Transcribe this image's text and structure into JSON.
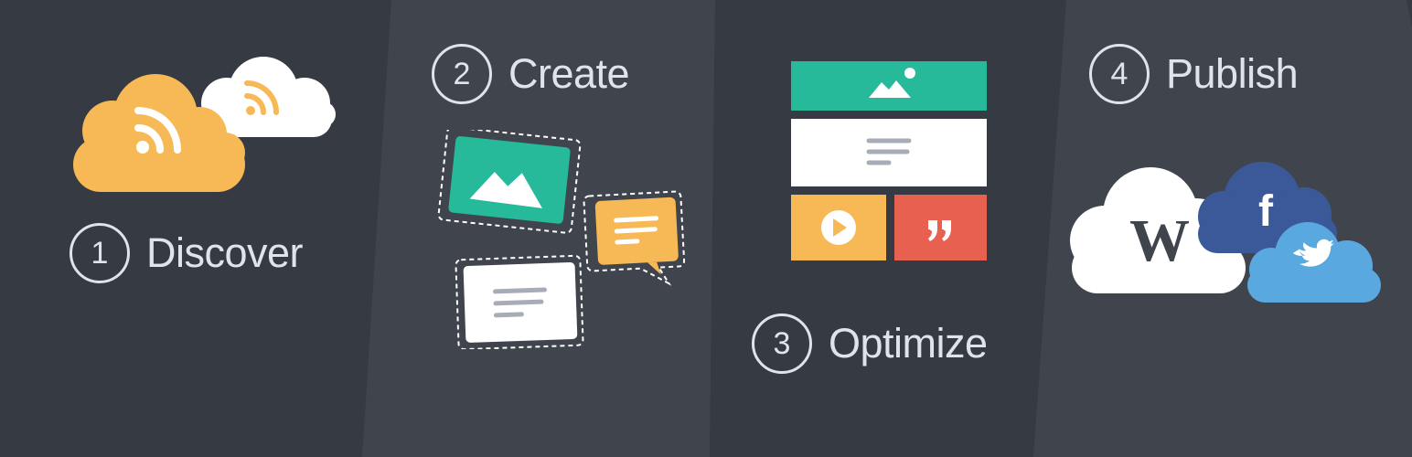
{
  "colors": {
    "panel_1": "#363a42",
    "panel_2": "#40454d",
    "panel_3": "#363a42",
    "panel_4": "#40454d",
    "text": "#dfe4ea",
    "rss_orange": "#f7b955",
    "teal": "#26b99a",
    "red": "#e8604f",
    "facebook_blue": "#3b5998",
    "twitter_blue": "#5aa8e0",
    "gray_lines": "#a6adb6"
  },
  "steps": [
    {
      "number": "1",
      "label": "Discover",
      "icon": "rss-clouds-icon"
    },
    {
      "number": "2",
      "label": "Create",
      "icon": "content-cards-icon"
    },
    {
      "number": "3",
      "label": "Optimize",
      "icon": "layout-grid-icon"
    },
    {
      "number": "4",
      "label": "Publish",
      "icon": "social-clouds-icon"
    }
  ],
  "publish_icons": {
    "wordpress_letter": "W",
    "facebook_letter": "f"
  }
}
